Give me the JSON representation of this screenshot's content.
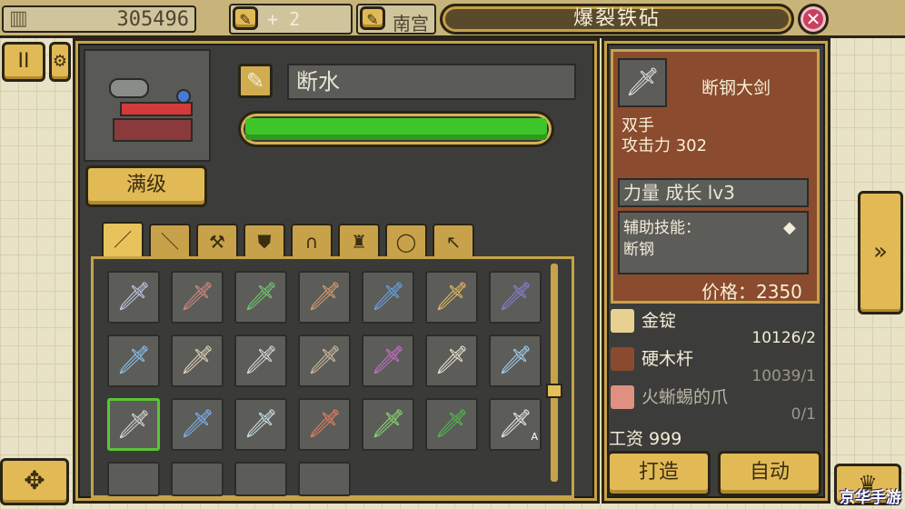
{
  "topbar": {
    "gold_amount": "305496",
    "item_count_label": "+ 2",
    "partial_label": "南宫",
    "title": "爆裂铁砧",
    "close_icon": "close-icon"
  },
  "machine": {
    "max_level_button": "满级",
    "weapon_name": "断水",
    "progress_fraction": 1.0
  },
  "tabs": [
    {
      "icon": "sword-icon",
      "glyph": "／"
    },
    {
      "icon": "spear-icon",
      "glyph": "＼"
    },
    {
      "icon": "axe-icon",
      "glyph": "⚒"
    },
    {
      "icon": "shield-icon",
      "glyph": "⛊"
    },
    {
      "icon": "helmet-icon",
      "glyph": "∩"
    },
    {
      "icon": "armor-icon",
      "glyph": "♜"
    },
    {
      "icon": "ring-icon",
      "glyph": "◯"
    },
    {
      "icon": "pickaxe-icon",
      "glyph": "↖"
    }
  ],
  "weapon_grid": [
    {
      "glyph": "🗡",
      "color": "#c8d0f0"
    },
    {
      "glyph": "🗡",
      "color": "#e08a80"
    },
    {
      "glyph": "🗡",
      "color": "#6fd46a"
    },
    {
      "glyph": "🗡",
      "color": "#e0a070"
    },
    {
      "glyph": "🗡",
      "color": "#6aa8f0"
    },
    {
      "glyph": "🗡",
      "color": "#f0c060"
    },
    {
      "glyph": "🗡",
      "color": "#8a80e0"
    },
    {
      "glyph": "🗡",
      "color": "#90c8f8"
    },
    {
      "glyph": "🗡",
      "color": "#e8d8c0"
    },
    {
      "glyph": "🗡",
      "color": "#e0e0e0"
    },
    {
      "glyph": "🗡",
      "color": "#d8c0a0"
    },
    {
      "glyph": "🗡",
      "color": "#d070d0"
    },
    {
      "glyph": "🗡",
      "color": "#f0e8d8"
    },
    {
      "glyph": "🗡",
      "color": "#a8d8f8"
    },
    {
      "glyph": "🗡",
      "color": "#e0e0e0",
      "selected": true
    },
    {
      "glyph": "🗡",
      "color": "#80b8f8"
    },
    {
      "glyph": "🗡",
      "color": "#d0e8f0"
    },
    {
      "glyph": "🗡",
      "color": "#f08060"
    },
    {
      "glyph": "🗡",
      "color": "#90e070"
    },
    {
      "glyph": "🗡",
      "color": "#50c050"
    },
    {
      "glyph": "🗡",
      "color": "#f0f0f0",
      "badge": "A"
    }
  ],
  "detail": {
    "name": "断钢大剑",
    "type": "双手",
    "attack_label": "攻击力 302",
    "growth": "力量 成长 lv3",
    "skill_label": "辅助技能：",
    "skill_name": "断钢",
    "price": "价格：2350",
    "materials": [
      {
        "name": "金锭",
        "qty": "",
        "icon": "gold-ingot-icon",
        "color": "#e8d090",
        "dim": false
      },
      {
        "name": "硬木杆",
        "qty": "10126/2",
        "icon": "hardwood-stick-icon",
        "color": "#8a4a30",
        "dim": false
      },
      {
        "name": "火蜥蜴的爪",
        "qty": "10039/1",
        "icon": "salamander-claw-icon",
        "color": "#e09080",
        "dim": true
      },
      {
        "name": "",
        "qty": "0/1",
        "icon": "",
        "color": "",
        "dim": true
      }
    ],
    "wage": "工资 999",
    "forge_button": "打造",
    "auto_button": "自动"
  },
  "side": {
    "pause_label": "II",
    "next_label": "»"
  },
  "watermark": "京华手游"
}
